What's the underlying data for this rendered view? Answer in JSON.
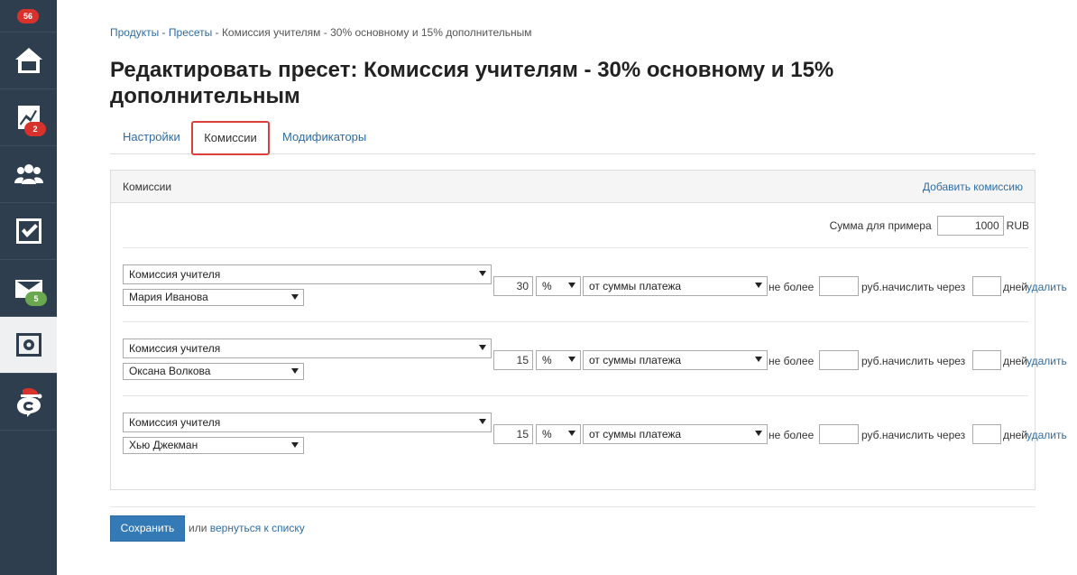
{
  "sidebar": {
    "notifications_badge": "56",
    "stats_badge": "2",
    "mail_badge": "5"
  },
  "breadcrumb": {
    "products": "Продукты",
    "presets": "Пресеты",
    "current": "Комиссия учителям - 30% основному и 15% дополнительным",
    "sep": " - "
  },
  "page": {
    "title": "Редактировать пресет: Комиссия учителям - 30% основному и 15% дополнительным"
  },
  "tabs": {
    "settings": "Настройки",
    "commissions": "Комиссии",
    "modifiers": "Модификаторы"
  },
  "panel": {
    "title": "Комиссии",
    "add_link": "Добавить комиссию",
    "sample_label": "Сумма для примера",
    "sample_value": "1000",
    "sample_currency": "RUB"
  },
  "labels": {
    "not_more": "не более",
    "rub_accrue": "руб.начислить через",
    "days": "дней",
    "delete": "удалить"
  },
  "commissions": [
    {
      "type": "Комиссия учителя",
      "person": "Мария Иванова",
      "value": "30",
      "unit": "%",
      "base": "от суммы платежа",
      "limit": "",
      "delay": ""
    },
    {
      "type": "Комиссия учителя",
      "person": "Оксана Волкова",
      "value": "15",
      "unit": "%",
      "base": "от суммы платежа",
      "limit": "",
      "delay": ""
    },
    {
      "type": "Комиссия учителя",
      "person": "Хью Джекман",
      "value": "15",
      "unit": "%",
      "base": "от суммы платежа",
      "limit": "",
      "delay": ""
    }
  ],
  "footer": {
    "save": "Сохранить",
    "or": "или",
    "back_link": "вернуться к списку"
  }
}
